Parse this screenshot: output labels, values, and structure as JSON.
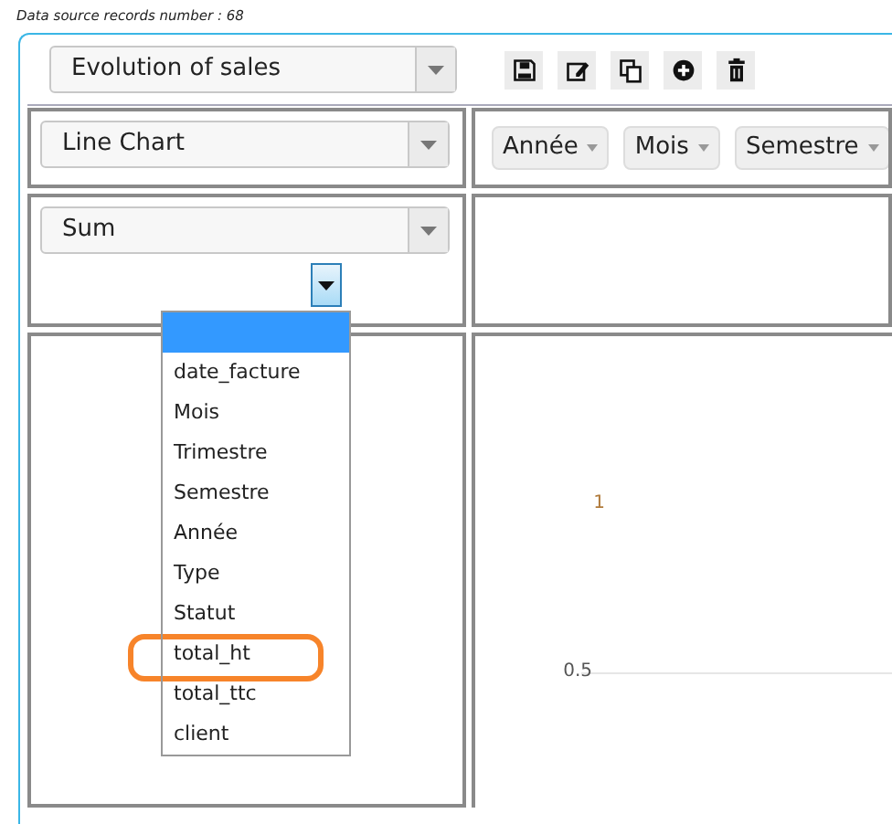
{
  "records_label": "Data source records number : 68",
  "report_select": {
    "value": "Evolution of sales"
  },
  "toolbar": [
    {
      "kind": "save"
    },
    {
      "kind": "edit"
    },
    {
      "kind": "copy"
    },
    {
      "kind": "add"
    },
    {
      "kind": "delete"
    }
  ],
  "chart_type_select": {
    "value": "Line Chart"
  },
  "column_fields": [
    "Année",
    "Mois",
    "Semestre"
  ],
  "aggregator_select": {
    "value": "Sum"
  },
  "attribute_dropdown": {
    "expanded": true,
    "items": [
      {
        "selected": true
      },
      {
        "label": "date_facture",
        "selected": false,
        "highlighted": false
      },
      {
        "label": "Mois",
        "selected": false,
        "highlighted": false
      },
      {
        "label": "Trimestre",
        "selected": false,
        "highlighted": false
      },
      {
        "label": "Semestre",
        "selected": false,
        "highlighted": false
      },
      {
        "label": "Année",
        "selected": false,
        "highlighted": false
      },
      {
        "label": "Type",
        "selected": false,
        "highlighted": false
      },
      {
        "label": "Statut",
        "selected": false,
        "highlighted": false
      },
      {
        "label": "total_ht",
        "selected": false,
        "highlighted": true
      },
      {
        "label": "total_ttc",
        "selected": false,
        "highlighted": false
      },
      {
        "label": "client",
        "selected": false,
        "highlighted": false
      }
    ]
  },
  "chart": {
    "y_ticks": [
      "1",
      "0.5"
    ]
  }
}
